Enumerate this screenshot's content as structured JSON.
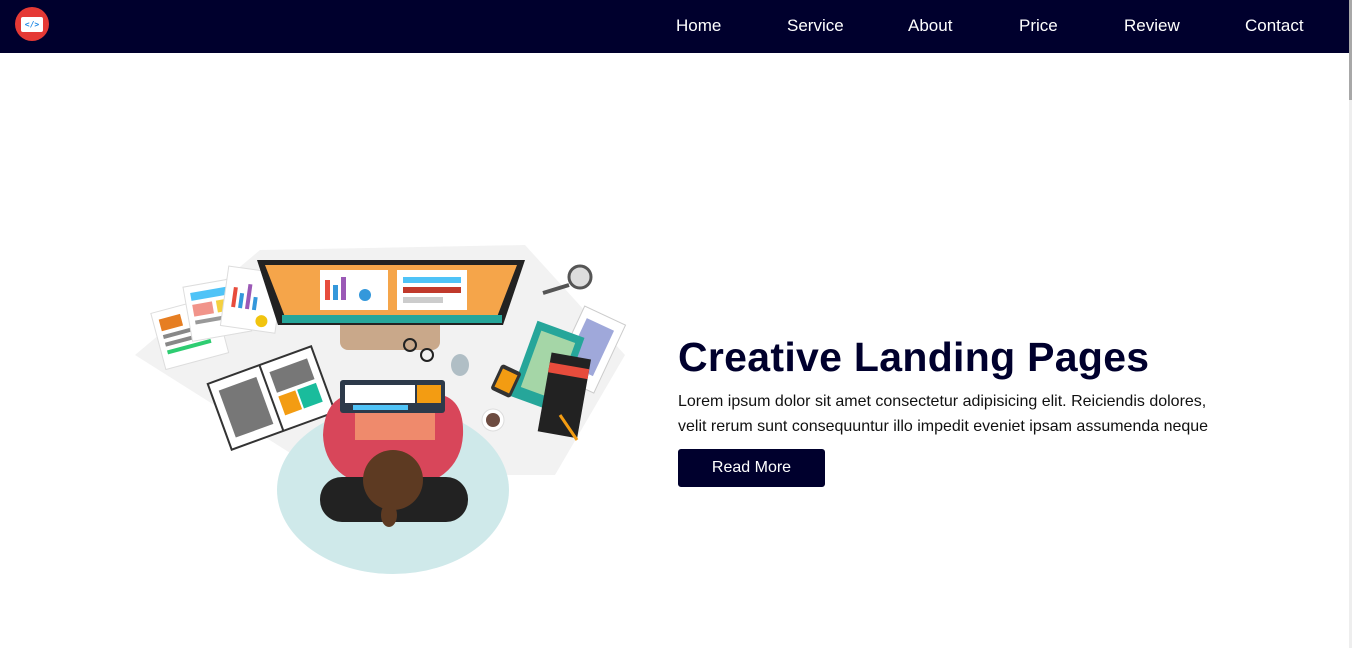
{
  "header": {
    "logo_icon": "code-icon",
    "logo_text": "</>",
    "nav": [
      {
        "label": "Home"
      },
      {
        "label": "Service"
      },
      {
        "label": "About"
      },
      {
        "label": "Price"
      },
      {
        "label": "Review"
      },
      {
        "label": "Contact"
      }
    ]
  },
  "hero": {
    "title": "Creative Landing Pages",
    "text": "Lorem ipsum dolor sit amet consectetur adipisicing elit. Reiciendis dolores, velit rerum sunt consequuntur illo impedit eveniet ipsam assumenda neque",
    "button_label": "Read More",
    "illustration_icon": "workspace-illustration"
  },
  "colors": {
    "nav_background": "#00002d",
    "accent": "#e53935",
    "button": "#00002d"
  }
}
